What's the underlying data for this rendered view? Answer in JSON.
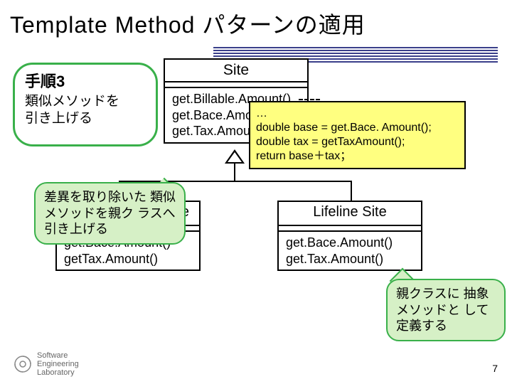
{
  "title": "Template Method パターンの適用",
  "step": {
    "heading": "手順3",
    "body_line1": "類似メソッドを",
    "body_line2": "引き上げる"
  },
  "site_class": {
    "name": "Site",
    "ops": "get.Billable.Amount()\nget.Bace.Amount()\nget.Tax.Amount()"
  },
  "residential_class": {
    "name_fragment": "ite",
    "ops": "get.Bace.Amount()\ngetTax.Amount()"
  },
  "lifeline_class": {
    "name": "Lifeline Site",
    "ops": "get.Bace.Amount()\nget.Tax.Amount()"
  },
  "code_note": "…\ndouble base = get.Bace. Amount();\ndouble tax = getTaxAmount();\nreturn base＋tax；",
  "callout_left": "差異を取り除いた\n類似メソッドを親ク\nラスへ引き上げる",
  "callout_right": "親クラスに\n抽象メソッドと\nして定義する",
  "footer": {
    "logo_line1": "Software",
    "logo_line2": "Engineering",
    "logo_line3": "Laboratory",
    "page": "7"
  }
}
